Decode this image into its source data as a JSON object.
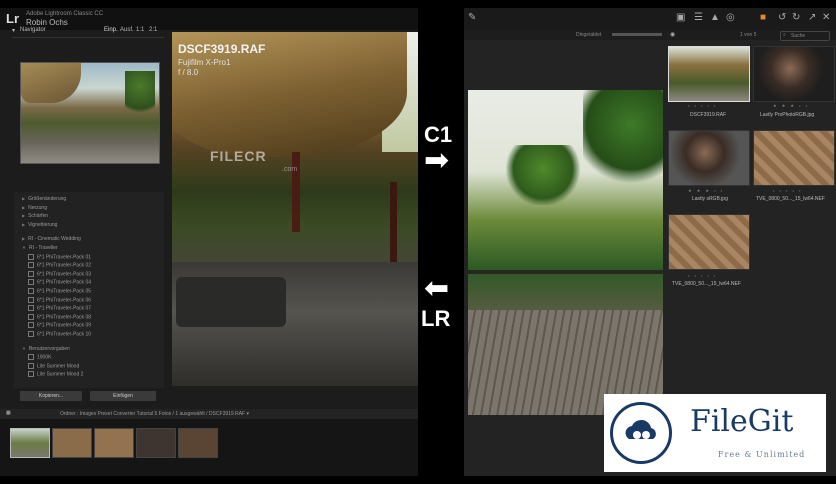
{
  "lightroom": {
    "logo": "Lr",
    "app_name": "Adobe Lightroom Classic CC",
    "user_name": "Robin Ochs",
    "navigator": {
      "title": "Navigator",
      "zoom_fit": "Einp.",
      "zoom_fill": "Ausf.",
      "zoom_1": "1:1",
      "zoom_2": "2:1"
    },
    "presets": [
      {
        "label": "Größenänderung",
        "kind": "tri"
      },
      {
        "label": "Nerzung",
        "kind": "tri"
      },
      {
        "label": "Schärfen",
        "kind": "tri"
      },
      {
        "label": "Vignettierung",
        "kind": "tri"
      },
      {
        "label": "RI - Cinematic Wedding",
        "kind": "tri"
      },
      {
        "label": "RI - Traveller",
        "kind": "open"
      },
      {
        "label": "6*1 PhiTraveler-Pack 01",
        "kind": "box"
      },
      {
        "label": "6*1 PhiTraveler-Pack 02",
        "kind": "box"
      },
      {
        "label": "6*1 PhiTraveler-Pack 03",
        "kind": "box"
      },
      {
        "label": "6*1 PhiTraveler-Pack 04",
        "kind": "box"
      },
      {
        "label": "6*1 PhiTraveler-Pack 05",
        "kind": "box"
      },
      {
        "label": "6*1 PhiTraveler-Pack 06",
        "kind": "box"
      },
      {
        "label": "6*1 PhiTraveler-Pack 07",
        "kind": "box"
      },
      {
        "label": "6*1 PhiTraveler-Pack 08",
        "kind": "box"
      },
      {
        "label": "6*1 PhiTraveler-Pack 09",
        "kind": "box"
      },
      {
        "label": "6*1 PhiTraveler-Pack 10",
        "kind": "box"
      },
      {
        "label": "Benutzervorgaben",
        "kind": "open"
      },
      {
        "label": "1900K",
        "kind": "box"
      },
      {
        "label": "Lite Summer Mood",
        "kind": "box"
      },
      {
        "label": "Lite Summer Mood 2",
        "kind": "box"
      }
    ],
    "buttons": {
      "import": "Kopieren...",
      "paste": "Einfügen"
    },
    "image": {
      "filename": "DSCF3919.RAF",
      "camera": "Fujifilm X-Pro1",
      "aperture": "f / 8.0"
    },
    "filmstrip_path": "Ordner : Images Preset Converter Tutorial   5 Fotos / 1 ausgewählt / DSCF3919.RAF ▾",
    "watermark_brand": "FILECR",
    "watermark_domain": ".com"
  },
  "middle": {
    "top_label": "C1",
    "top_arrow": "➡",
    "bottom_arrow": "⬅",
    "bottom_label": "LR"
  },
  "captureone": {
    "toolbar_icons": [
      "grid-icon",
      "warning-icon",
      "glasses-icon"
    ],
    "sort_label": "Dingetablet",
    "count_label": "1 von 5",
    "search_placeholder": "Suche",
    "thumbnails": [
      {
        "caption": "DSCF3919.RAF",
        "stars": "• • • • •"
      },
      {
        "caption": "Lastly ProPhotoRGB.jpg",
        "stars": "★ ★ ★ • •"
      },
      {
        "caption": "Lastly sRGB.jpg",
        "stars": "★ ★ ★ • •"
      },
      {
        "caption": "TVE_0800_50..._15_lw64.NEF",
        "stars": "• • • • •"
      },
      {
        "caption": "TVE_0800_50..._15_lw64.NEF",
        "stars": "• • • • •"
      }
    ]
  },
  "filegit": {
    "title": "FileGit",
    "subtitle": "Free & Unlimited"
  }
}
